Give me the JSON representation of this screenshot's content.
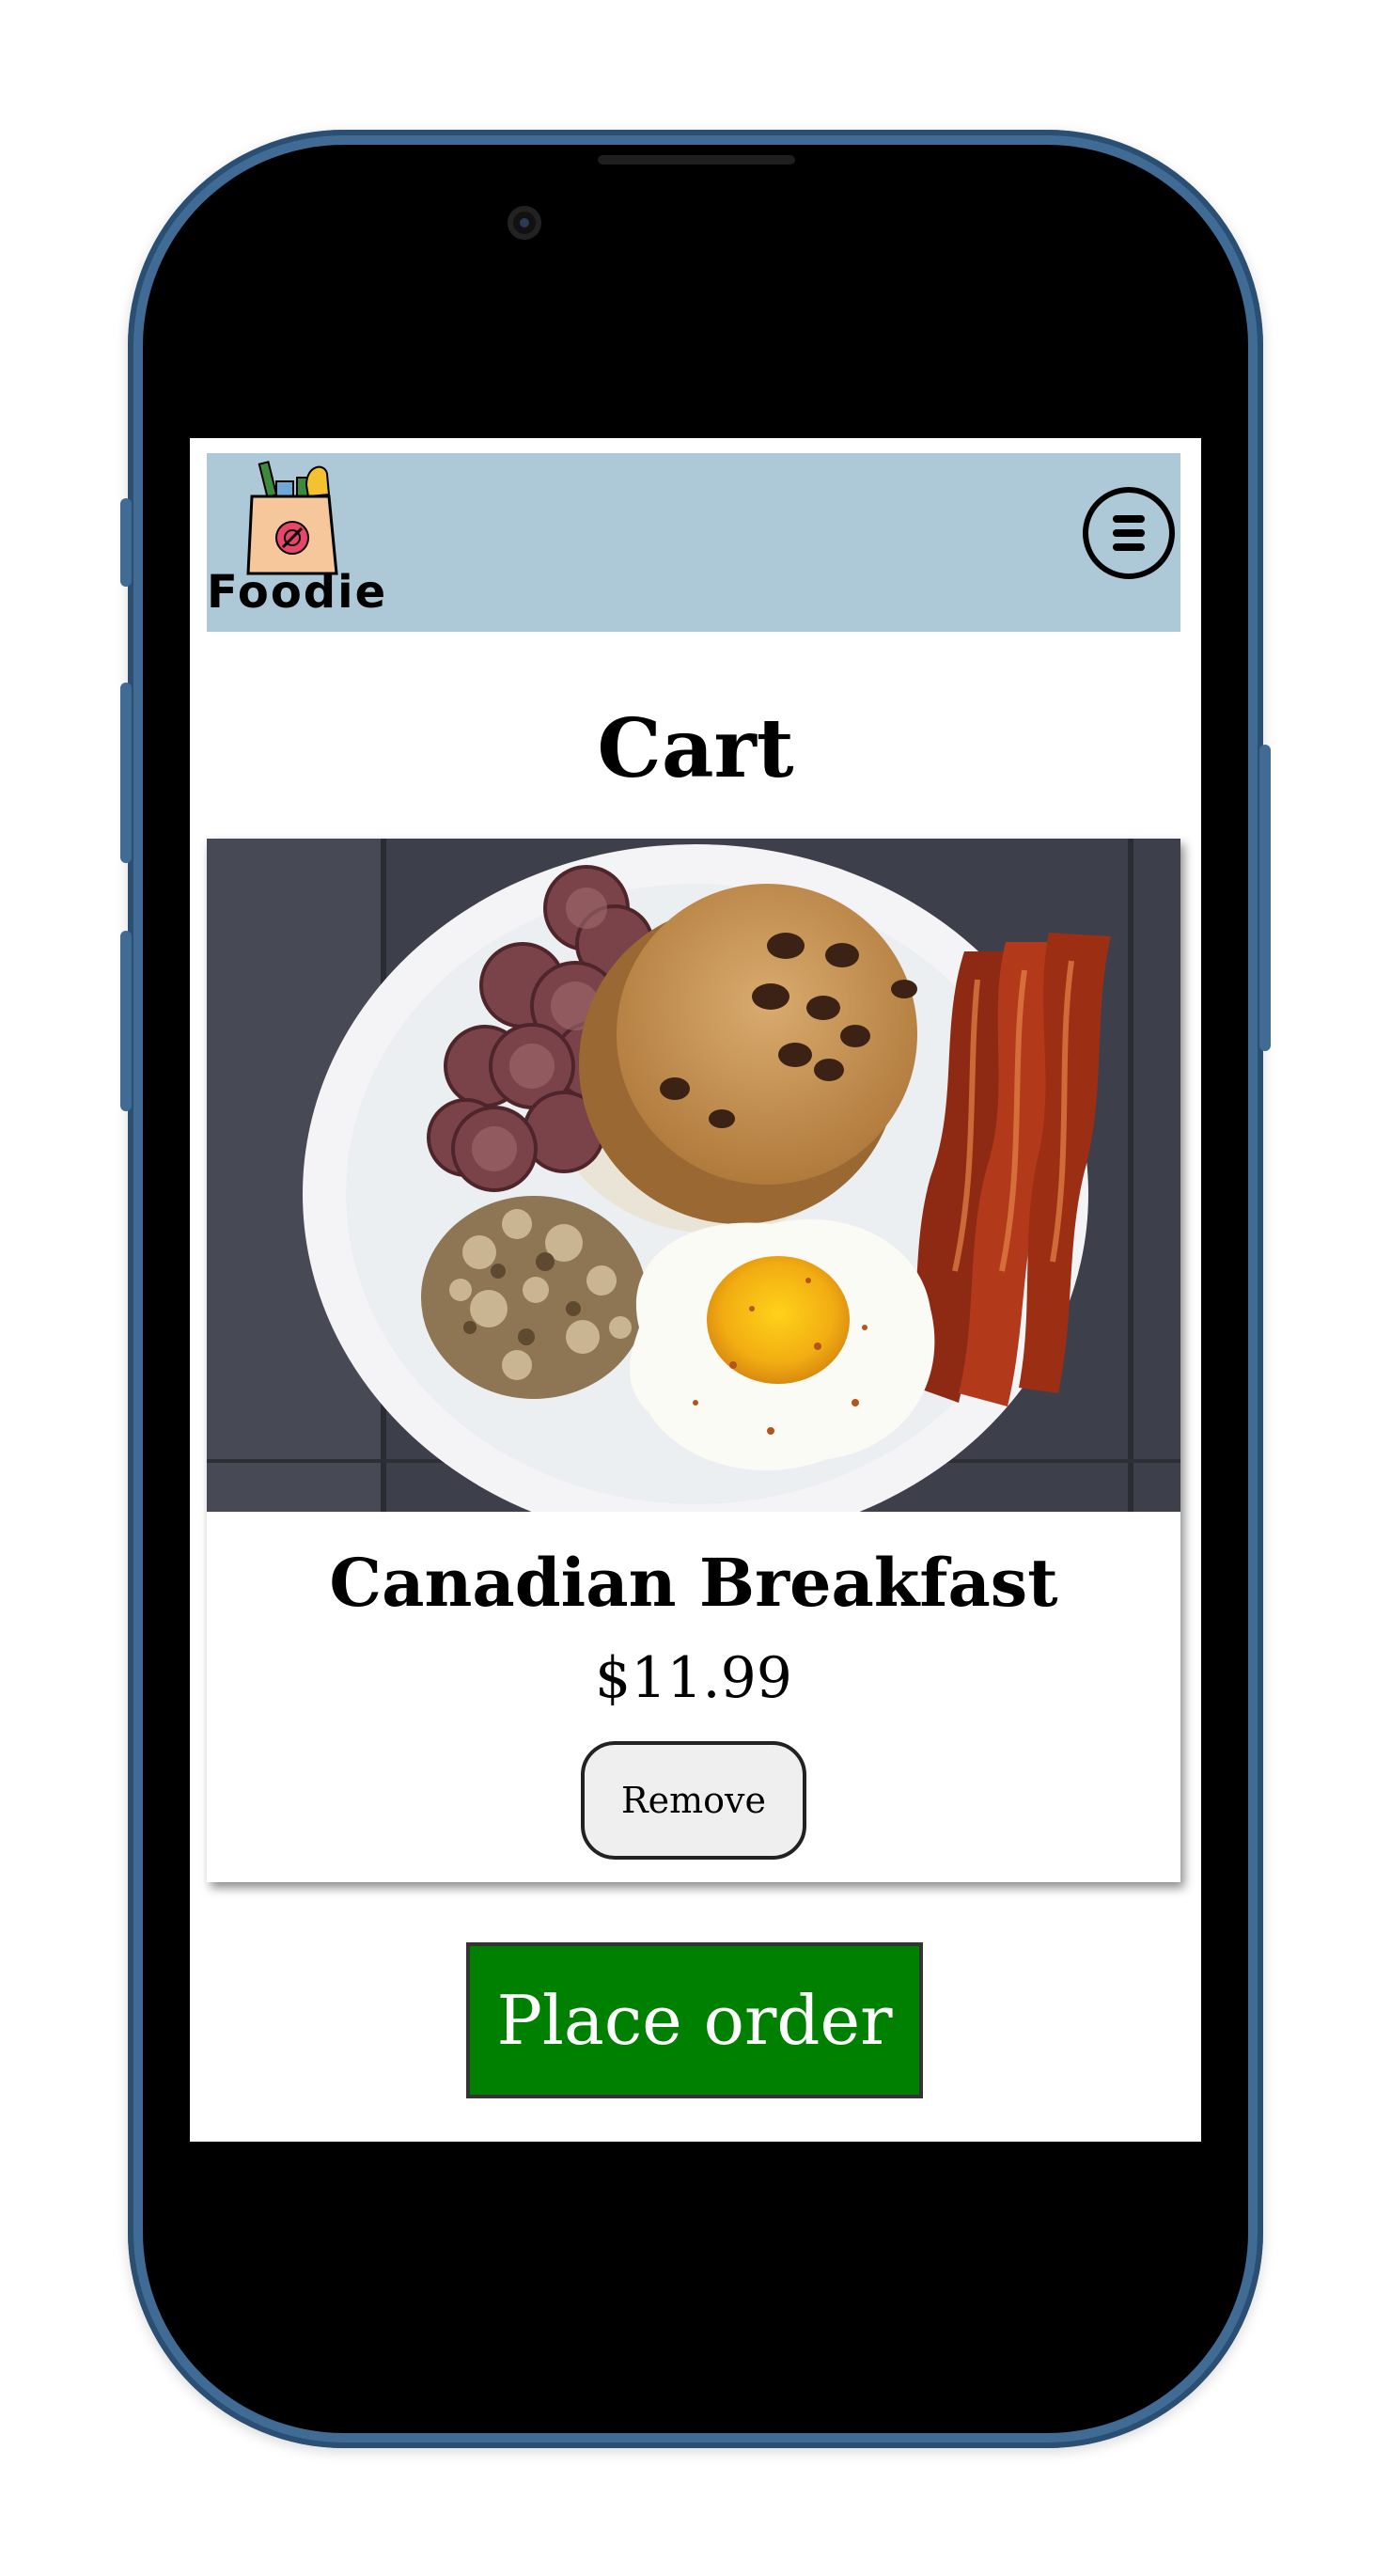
{
  "header": {
    "logo_text": "Foodie",
    "menu_icon": "hamburger-menu-icon",
    "background_color": "#adc8d6"
  },
  "page": {
    "title": "Cart"
  },
  "cart": {
    "items": [
      {
        "name": "Canadian Breakfast",
        "price": "$11.99",
        "remove_label": "Remove",
        "image_alt": "Plate with pancakes, sausage slices, hash browns, fried egg and bacon"
      }
    ]
  },
  "actions": {
    "place_order_label": "Place order",
    "place_order_color": "#008000"
  }
}
